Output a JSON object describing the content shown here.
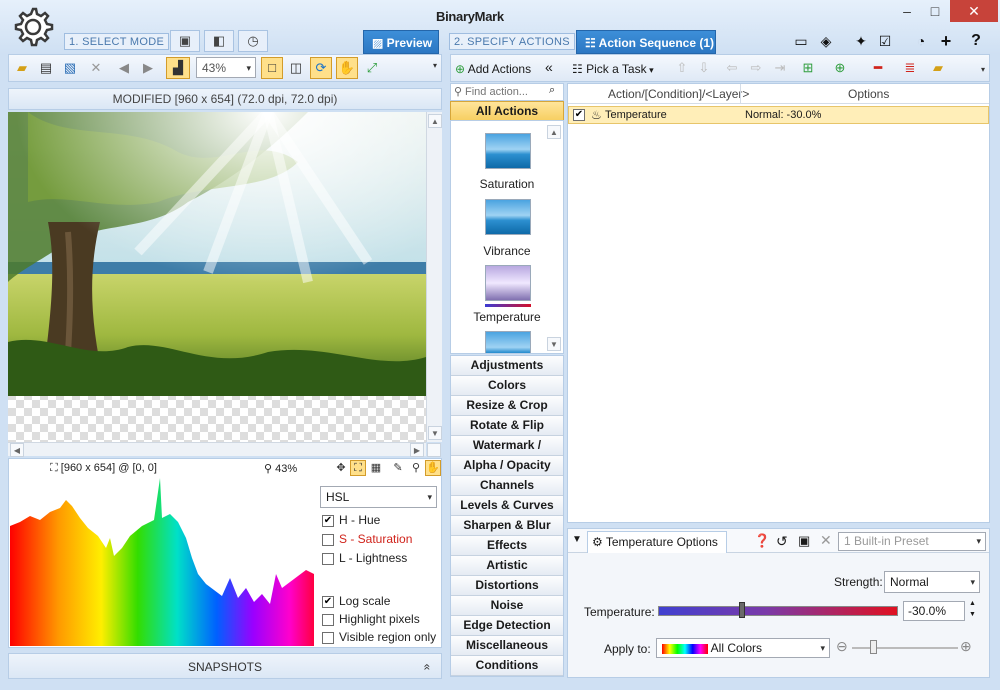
{
  "app": {
    "brand": "BinaryMark"
  },
  "window": {
    "minimize": "–",
    "maximize": "□",
    "close": "✕"
  },
  "modes": {
    "select_mode": "1. SELECT MODE",
    "specify_actions": "2. SPECIFY ACTIONS",
    "preview_tab": "Preview",
    "sequence_tab": "Action Sequence (1)"
  },
  "toolbar_left": {
    "zoom": "43%"
  },
  "image": {
    "header": "MODIFIED [960 x 654] (72.0 dpi, 72.0 dpi)",
    "dims_info": "[960 x 654] @ [0, 0]",
    "zoom_info": "43%"
  },
  "histogram": {
    "mode": "HSL",
    "channels": [
      {
        "label": "H - Hue",
        "checked": true,
        "color": "#222222"
      },
      {
        "label": "S - Saturation",
        "checked": false,
        "color": "#d0231b"
      },
      {
        "label": "L - Lightness",
        "checked": false,
        "color": "#222222"
      }
    ],
    "options": [
      {
        "label": "Log scale",
        "checked": true
      },
      {
        "label": "Highlight pixels",
        "checked": false
      },
      {
        "label": "Visible region only",
        "checked": false
      }
    ]
  },
  "snapshots": {
    "label": "SNAPSHOTS",
    "toggle": "«"
  },
  "actions_panel": {
    "add_actions": "Add Actions",
    "collapse": "«",
    "search_placeholder": "Find action...",
    "all_actions": "All Actions",
    "gallery": [
      {
        "label": "Saturation"
      },
      {
        "label": "Vibrance"
      },
      {
        "label": "Temperature"
      }
    ],
    "categories": [
      "Adjustments",
      "Colors",
      "Resize & Crop",
      "Rotate & Flip",
      "Watermark / Overlay",
      "Alpha / Opacity",
      "Channels",
      "Levels & Curves",
      "Sharpen & Blur",
      "Effects",
      "Artistic",
      "Distortions",
      "Noise",
      "Edge Detection",
      "Miscellaneous",
      "Conditions"
    ]
  },
  "sequence": {
    "pick_task": "Pick a Task",
    "col_action": "Action/[Condition]/<Layer>",
    "col_options": "Options",
    "rows": [
      {
        "name": "Temperature",
        "options": "Normal: -30.0%",
        "checked": true
      }
    ]
  },
  "options_panel": {
    "title": "Temperature Options",
    "preset": "1 Built-in Preset",
    "strength_label": "Strength:",
    "strength_value": "Normal",
    "temperature_label": "Temperature:",
    "temperature_value": "-30.0%",
    "temperature_fraction": 0.35,
    "apply_label": "Apply to:",
    "apply_value": "All Colors",
    "zoom_fraction": 0.2
  }
}
